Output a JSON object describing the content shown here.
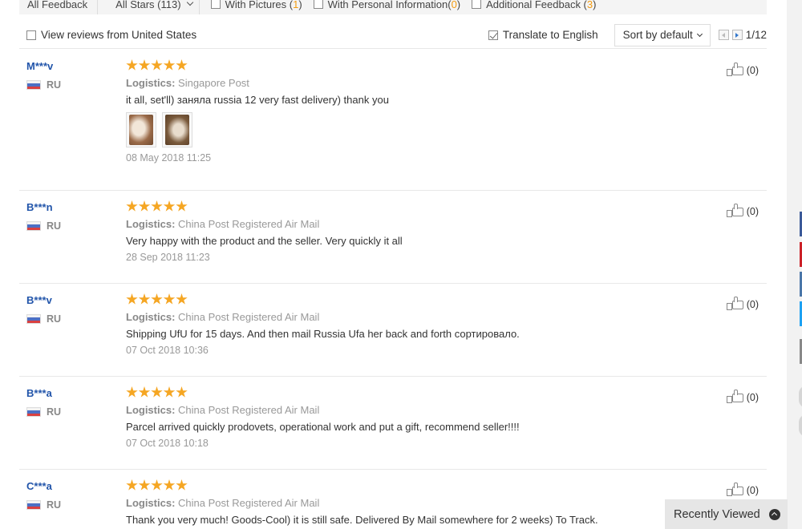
{
  "filter_bar": {
    "all_feedback": "All Feedback",
    "all_stars": "All Stars (113)",
    "with_pictures_label": "With Pictures (",
    "with_pictures_count": "1",
    "with_personal_label": "With Personal Information(",
    "with_personal_count": "0",
    "additional_label": "Additional Feedback (",
    "additional_count": "3",
    "close_paren": ")"
  },
  "controls": {
    "view_us": "View reviews from United States",
    "translate": "Translate to English",
    "sort": "Sort by default",
    "page": "1/12"
  },
  "reviews": [
    {
      "user": "M***v",
      "country": "RU",
      "logistics_label": "Logistics:",
      "logistics": "Singapore Post",
      "text": "it all, set'll) заняла russia 12 very fast delivery) thank you",
      "date": "08 May 2018 11:25",
      "helpful": "(0)",
      "stars": 5,
      "photos": 2
    },
    {
      "user": "B***n",
      "country": "RU",
      "logistics_label": "Logistics:",
      "logistics": "China Post Registered Air Mail",
      "text": "Very happy with the product and the seller. Very quickly it all",
      "date": "28 Sep 2018 11:23",
      "helpful": "(0)",
      "stars": 5
    },
    {
      "user": "B***v",
      "country": "RU",
      "logistics_label": "Logistics:",
      "logistics": "China Post Registered Air Mail",
      "text": "Shipping UfU for 15 days. And then mail Russia Ufa her back and forth сортировало.",
      "date": "07 Oct 2018 10:36",
      "helpful": "(0)",
      "stars": 5
    },
    {
      "user": "B***a",
      "country": "RU",
      "logistics_label": "Logistics:",
      "logistics": "China Post Registered Air Mail",
      "text": "Parcel arrived quickly prodovets, operational work and put a gift, recommend seller!!!!",
      "date": "07 Oct 2018 10:18",
      "helpful": "(0)",
      "stars": 5
    },
    {
      "user": "C***a",
      "country": "RU",
      "logistics_label": "Logistics:",
      "logistics": "China Post Registered Air Mail",
      "text": "Thank you very much! Goods-Cool) it is still safe. Delivered By Mail somewhere for 2 weeks) To Track.",
      "helpful": "(0)",
      "stars": 5
    }
  ],
  "recently_viewed": "Recently Viewed",
  "colors": {
    "username": "#2255aa",
    "star": "#f5a623",
    "count_highlight": "#f39c12"
  },
  "icons": [
    "chevron-down-icon",
    "checkbox-icon",
    "star-icon",
    "thumbs-up-icon",
    "flag-ru-icon",
    "prev-page-icon",
    "next-page-icon",
    "chevron-up-circle-icon"
  ]
}
